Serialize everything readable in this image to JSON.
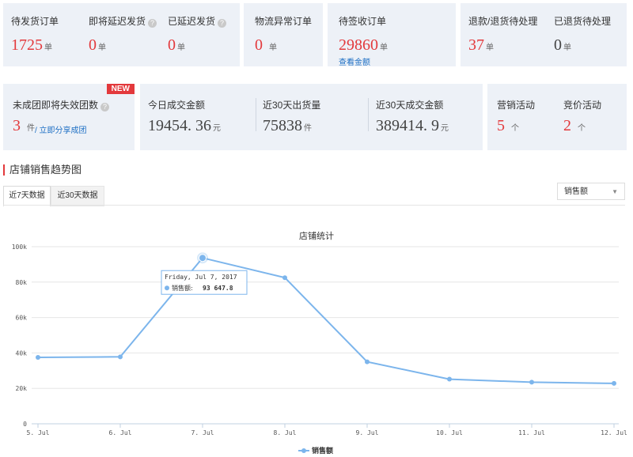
{
  "top_stats": {
    "pending_ship": {
      "label": "待发货订单",
      "value": "1725",
      "unit": "单"
    },
    "about_to_delay": {
      "label": "即将延迟发货",
      "value": "0",
      "unit": "单"
    },
    "delayed": {
      "label": "已延迟发货",
      "value": "0",
      "unit": "单"
    },
    "logistics_abnormal": {
      "label": "物流异常订单",
      "value": "0",
      "unit": "单"
    },
    "pending_receipt": {
      "label": "待签收订单",
      "value": "29860",
      "unit": "单",
      "link": "查看金额"
    },
    "refund_pending": {
      "label": "退款/退货待处理",
      "value": "37",
      "unit": "单"
    },
    "returned_pending": {
      "label": "已退货待处理",
      "value": "0",
      "unit": "单"
    }
  },
  "row2": {
    "group_buy": {
      "label": "未成团即将失效团数",
      "value": "3",
      "unit": "件",
      "link": "/ 立即分享成团",
      "badge": "NEW"
    },
    "today_amount": {
      "label": "今日成交金额",
      "value": "19454. 36",
      "unit": "元"
    },
    "ship_30d": {
      "label": "近30天出货量",
      "value": "75838",
      "unit": "件"
    },
    "amount_30d": {
      "label": "近30天成交金额",
      "value": "389414. 9",
      "unit": "元"
    },
    "marketing": {
      "label": "营销活动",
      "value": "5",
      "unit": "个"
    },
    "bidding": {
      "label": "竞价活动",
      "value": "2",
      "unit": "个"
    }
  },
  "section_title": "店铺销售趋势图",
  "tabs": [
    "近7天数据",
    "近30天数据"
  ],
  "metric_select": "销售额",
  "help_icon": "question-circle-icon",
  "colors": {
    "accent": "#e3393c",
    "line": "#7cb5ec",
    "link": "#1d6fc4"
  },
  "chart_data": {
    "type": "line",
    "title": "店铺统计",
    "categories": [
      "5. Jul",
      "6. Jul",
      "7. Jul",
      "8. Jul",
      "9. Jul",
      "10. Jul",
      "11. Jul",
      "12. Jul"
    ],
    "series": [
      {
        "name": "销售额",
        "values": [
          37500,
          37800,
          93647.8,
          82500,
          35000,
          25200,
          23500,
          22800
        ]
      }
    ],
    "y_ticks": [
      "0",
      "20k",
      "40k",
      "60k",
      "80k",
      "100k"
    ],
    "ylim": [
      0,
      100000
    ],
    "grid": true,
    "legend": "bottom-center",
    "tooltip": {
      "title": "Friday, Jul 7, 2017",
      "series": "销售额",
      "value": "93 647.8"
    }
  }
}
